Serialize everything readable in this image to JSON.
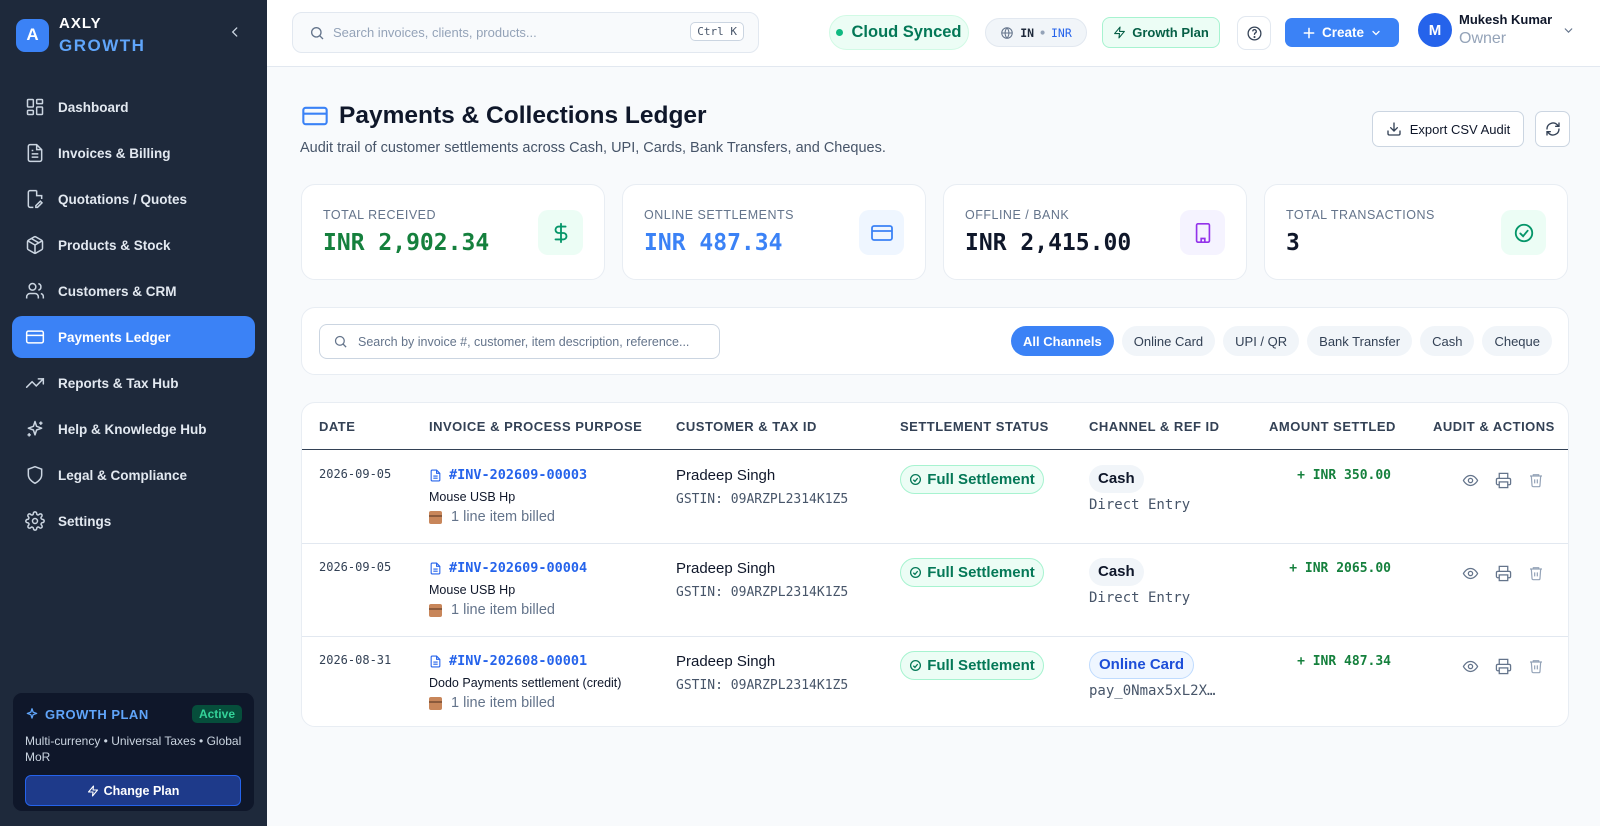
{
  "brand": {
    "logo_letter": "A",
    "name": "AXLY",
    "tier": "GROWTH"
  },
  "sidebar": {
    "items": [
      {
        "label": "Dashboard",
        "icon": "grid-icon"
      },
      {
        "label": "Invoices & Billing",
        "icon": "file-text-icon"
      },
      {
        "label": "Quotations / Quotes",
        "icon": "file-edit-icon"
      },
      {
        "label": "Products & Stock",
        "icon": "package-icon"
      },
      {
        "label": "Customers & CRM",
        "icon": "users-icon"
      },
      {
        "label": "Payments Ledger",
        "icon": "credit-card-icon",
        "active": true
      },
      {
        "label": "Reports & Tax Hub",
        "icon": "trending-up-icon"
      },
      {
        "label": "Help & Knowledge Hub",
        "icon": "sparkles-icon"
      },
      {
        "label": "Legal & Compliance",
        "icon": "shield-icon"
      },
      {
        "label": "Settings",
        "icon": "gear-icon"
      }
    ],
    "plan": {
      "title": "GROWTH PLAN",
      "badge": "Active",
      "description": "Multi-currency • Universal Taxes • Global MoR",
      "button": "Change Plan"
    }
  },
  "topbar": {
    "search_placeholder": "Search invoices, clients, products...",
    "shortcut": "Ctrl K",
    "sync_status": "Cloud Synced",
    "locale_country": "IN",
    "locale_separator": "•",
    "locale_currency": "INR",
    "plan_label": "Growth Plan",
    "create_label": "Create",
    "user": {
      "initial": "M",
      "name": "Mukesh Kumar",
      "role": "Owner"
    }
  },
  "page": {
    "title": "Payments & Collections Ledger",
    "subtitle": "Audit trail of customer settlements across Cash, UPI, Cards, Bank Transfers, and Cheques.",
    "export_label": "Export CSV Audit"
  },
  "stats": [
    {
      "label": "TOTAL RECEIVED",
      "value": "INR 2,902.34",
      "color": "#15803d",
      "icon": "dollar-icon"
    },
    {
      "label": "ONLINE SETTLEMENTS",
      "value": "INR 487.34",
      "color": "#3b82f6",
      "icon": "credit-card-icon"
    },
    {
      "label": "OFFLINE / BANK",
      "value": "INR 2,415.00",
      "color": "#0f172a",
      "icon": "building-icon"
    },
    {
      "label": "TOTAL TRANSACTIONS",
      "value": "3",
      "color": "#0f172a",
      "icon": "check-circle-icon"
    }
  ],
  "filters": {
    "search_placeholder": "Search by invoice #, customer, item description, reference...",
    "chips": [
      "All Channels",
      "Online Card",
      "UPI / QR",
      "Bank Transfer",
      "Cash",
      "Cheque"
    ],
    "active_chip": "All Channels"
  },
  "table": {
    "headers": [
      "DATE",
      "INVOICE & PROCESS PURPOSE",
      "CUSTOMER & TAX ID",
      "SETTLEMENT STATUS",
      "CHANNEL & REF ID",
      "AMOUNT SETTLED",
      "AUDIT & ACTIONS"
    ],
    "rows": [
      {
        "date": "2026-09-05",
        "invoice": "#INV-202609-00003",
        "description": "Mouse USB Hp",
        "items": "1 line item billed",
        "customer": "Pradeep Singh",
        "tax_id": "GSTIN: 09ARZPL2314K1Z5",
        "status": "Full Settlement",
        "channel": "Cash",
        "channel_type": "offline",
        "ref": "Direct Entry",
        "amount": "+ INR 350.00"
      },
      {
        "date": "2026-09-05",
        "invoice": "#INV-202609-00004",
        "description": "Mouse USB Hp",
        "items": "1 line item billed",
        "customer": "Pradeep Singh",
        "tax_id": "GSTIN: 09ARZPL2314K1Z5",
        "status": "Full Settlement",
        "channel": "Cash",
        "channel_type": "offline",
        "ref": "Direct Entry",
        "amount": "+ INR 2065.00"
      },
      {
        "date": "2026-08-31",
        "invoice": "#INV-202608-00001",
        "description": "Dodo Payments settlement (credit)",
        "items": "1 line item billed",
        "customer": "Pradeep Singh",
        "tax_id": "GSTIN: 09ARZPL2314K1Z5",
        "status": "Full Settlement",
        "channel": "Online Card",
        "channel_type": "online",
        "ref": "pay_0Nmax5xL2X…",
        "amount": "+ INR 487.34"
      }
    ]
  },
  "colors": {
    "accent": "#3b82f6",
    "sidebar_bg": "#1e293b",
    "success": "#15803d"
  }
}
